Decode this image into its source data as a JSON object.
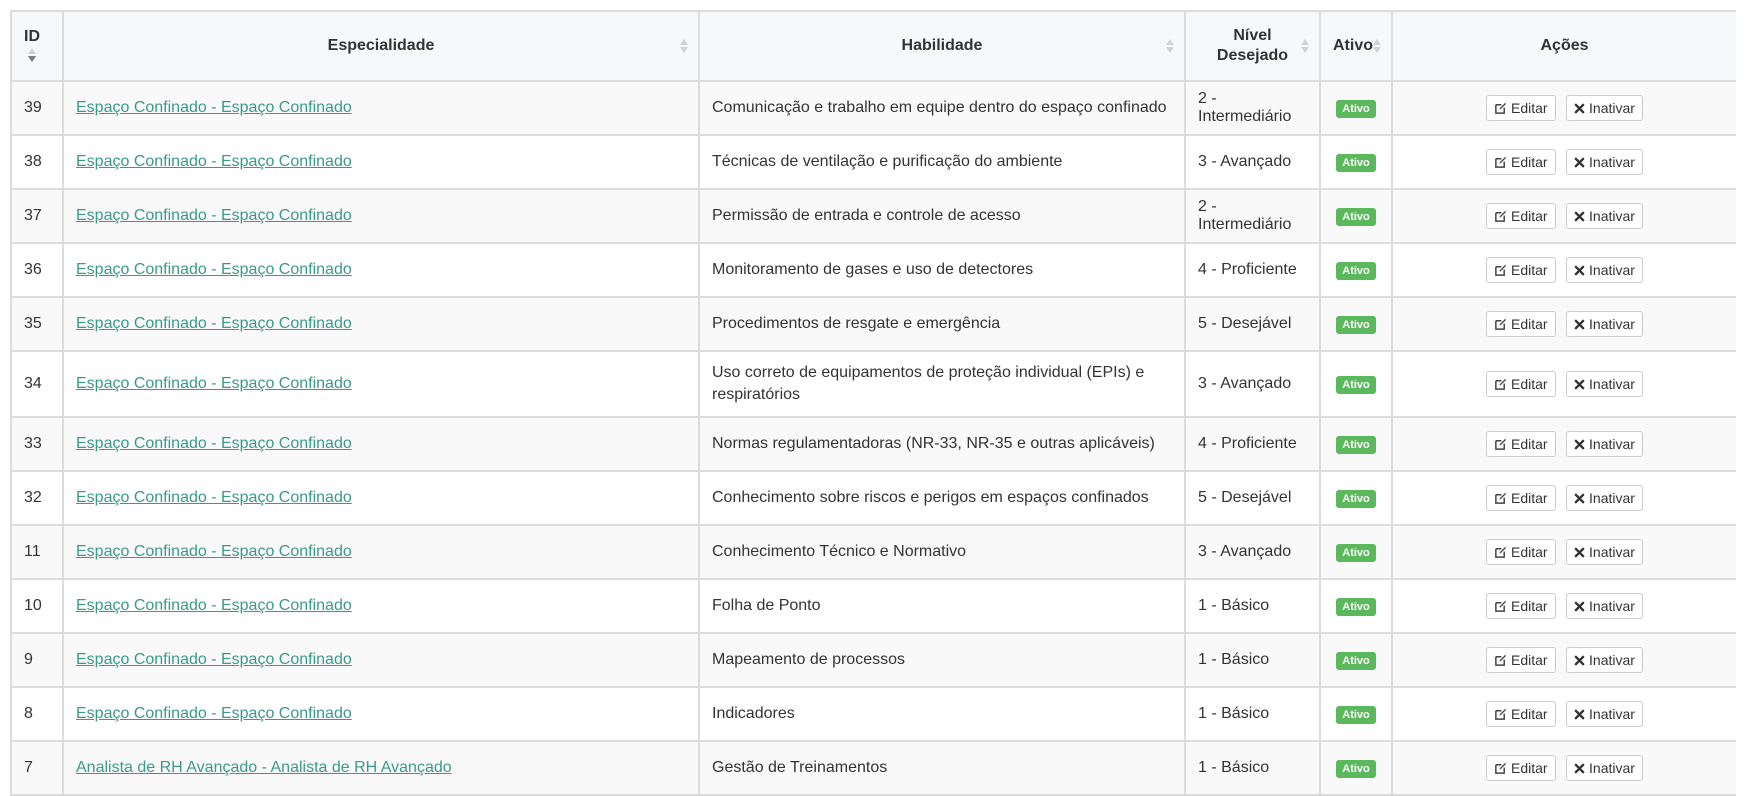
{
  "table": {
    "headers": {
      "id": "ID",
      "especialidade": "Especialidade",
      "habilidade": "Habilidade",
      "nivel": "Nível Desejado",
      "ativo": "Ativo",
      "acoes": "Ações"
    },
    "rows": [
      {
        "id": "39",
        "especialidade": "Espaço Confinado - Espaço Confinado",
        "habilidade": "Comunicação e trabalho em equipe dentro do espaço confinado",
        "nivel": "2 - Intermediário",
        "ativo": "Ativo",
        "edit": "Editar",
        "inactivate": "Inativar"
      },
      {
        "id": "38",
        "especialidade": "Espaço Confinado - Espaço Confinado",
        "habilidade": "Técnicas de ventilação e purificação do ambiente",
        "nivel": "3 - Avançado",
        "ativo": "Ativo",
        "edit": "Editar",
        "inactivate": "Inativar"
      },
      {
        "id": "37",
        "especialidade": "Espaço Confinado - Espaço Confinado",
        "habilidade": "Permissão de entrada e controle de acesso",
        "nivel": "2 - Intermediário",
        "ativo": "Ativo",
        "edit": "Editar",
        "inactivate": "Inativar"
      },
      {
        "id": "36",
        "especialidade": "Espaço Confinado - Espaço Confinado",
        "habilidade": "Monitoramento de gases e uso de detectores",
        "nivel": "4 - Proficiente",
        "ativo": "Ativo",
        "edit": "Editar",
        "inactivate": "Inativar"
      },
      {
        "id": "35",
        "especialidade": "Espaço Confinado - Espaço Confinado",
        "habilidade": "Procedimentos de resgate e emergência",
        "nivel": "5 - Desejável",
        "ativo": "Ativo",
        "edit": "Editar",
        "inactivate": "Inativar"
      },
      {
        "id": "34",
        "especialidade": "Espaço Confinado - Espaço Confinado",
        "habilidade": "Uso correto de equipamentos de proteção individual (EPIs) e respiratórios",
        "nivel": "3 - Avançado",
        "ativo": "Ativo",
        "edit": "Editar",
        "inactivate": "Inativar"
      },
      {
        "id": "33",
        "especialidade": "Espaço Confinado - Espaço Confinado",
        "habilidade": "Normas regulamentadoras (NR-33, NR-35 e outras aplicáveis)",
        "nivel": "4 - Proficiente",
        "ativo": "Ativo",
        "edit": "Editar",
        "inactivate": "Inativar"
      },
      {
        "id": "32",
        "especialidade": "Espaço Confinado - Espaço Confinado",
        "habilidade": "Conhecimento sobre riscos e perigos em espaços confinados",
        "nivel": "5 - Desejável",
        "ativo": "Ativo",
        "edit": "Editar",
        "inactivate": "Inativar"
      },
      {
        "id": "11",
        "especialidade": "Espaço Confinado - Espaço Confinado",
        "habilidade": "Conhecimento Técnico e Normativo",
        "nivel": "3 - Avançado",
        "ativo": "Ativo",
        "edit": "Editar",
        "inactivate": "Inativar"
      },
      {
        "id": "10",
        "especialidade": "Espaço Confinado - Espaço Confinado",
        "habilidade": "Folha de Ponto",
        "nivel": "1 - Básico",
        "ativo": "Ativo",
        "edit": "Editar",
        "inactivate": "Inativar"
      },
      {
        "id": "9",
        "especialidade": "Espaço Confinado - Espaço Confinado",
        "habilidade": "Mapeamento de processos",
        "nivel": "1 - Básico",
        "ativo": "Ativo",
        "edit": "Editar",
        "inactivate": "Inativar"
      },
      {
        "id": "8",
        "especialidade": "Espaço Confinado - Espaço Confinado",
        "habilidade": "Indicadores",
        "nivel": "1 - Básico",
        "ativo": "Ativo",
        "edit": "Editar",
        "inactivate": "Inativar"
      },
      {
        "id": "7",
        "especialidade": "Analista de RH Avançado - Analista de RH Avançado",
        "habilidade": "Gestão de Treinamentos",
        "nivel": "1 - Básico",
        "ativo": "Ativo",
        "edit": "Editar",
        "inactivate": "Inativar"
      }
    ]
  },
  "colors": {
    "link": "#3a9a8a",
    "badge": "#5cb85c",
    "border": "#dcdcdc"
  },
  "icons": {
    "sort": "sort-icon",
    "edit": "edit-icon",
    "inactivate": "close-icon"
  }
}
